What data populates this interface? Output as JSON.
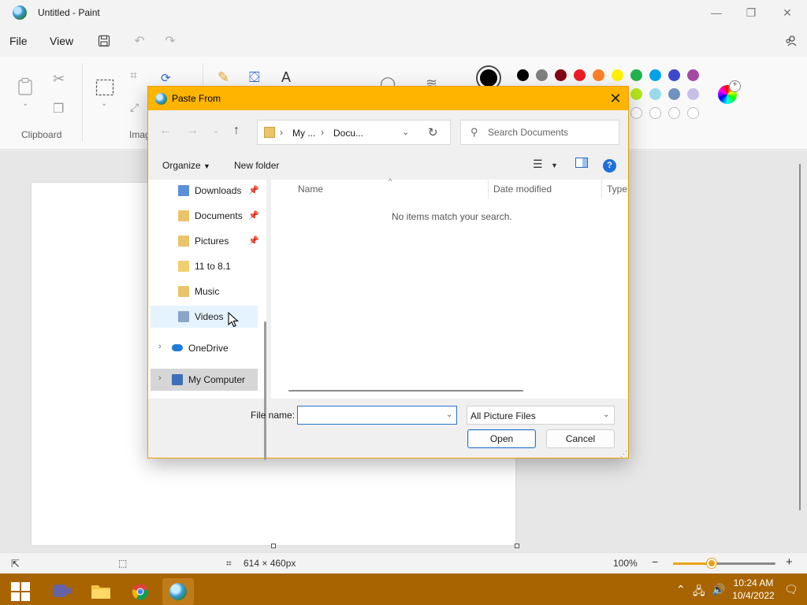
{
  "app": {
    "title": "Untitled - Paint"
  },
  "menubar": {
    "file": "File",
    "view": "View"
  },
  "ribbon": {
    "clipboard_label": "Clipboard",
    "image_label": "Imag",
    "palette": [
      "#000000",
      "#7f7f7f",
      "#880015",
      "#ed1c24",
      "#ff7f27",
      "#fff200",
      "#22b14c",
      "#00a2e8",
      "#3f48cc",
      "#a349a4",
      "#b5e61d",
      "#99d9ea",
      "#7092be",
      "#c8bfe7"
    ]
  },
  "dialog": {
    "title": "Paste From",
    "address": {
      "part1": "My ...",
      "part2": "Docu..."
    },
    "search_placeholder": "Search Documents",
    "toolbar": {
      "organize": "Organize",
      "new_folder": "New folder"
    },
    "nav_items": [
      {
        "label": "Downloads",
        "pinned": true
      },
      {
        "label": "Documents",
        "pinned": true
      },
      {
        "label": "Pictures",
        "pinned": true
      },
      {
        "label": "11 to 8.1",
        "pinned": false
      },
      {
        "label": "Music",
        "pinned": false
      },
      {
        "label": "Videos",
        "pinned": false
      }
    ],
    "nav_roots": {
      "onedrive": "OneDrive",
      "my_computer": "My Computer"
    },
    "columns": {
      "name": "Name",
      "date_modified": "Date modified",
      "type": "Type"
    },
    "empty_message": "No items match your search.",
    "file_name_label": "File name:",
    "file_name_value": "",
    "file_type": "All Picture Files",
    "open_label": "Open",
    "cancel_label": "Cancel"
  },
  "statusbar": {
    "dimensions": "614 × 460px",
    "zoom": "100%",
    "zoom_fraction": 0.38
  },
  "taskbar": {
    "time": "10:24 AM",
    "date": "10/4/2022"
  }
}
